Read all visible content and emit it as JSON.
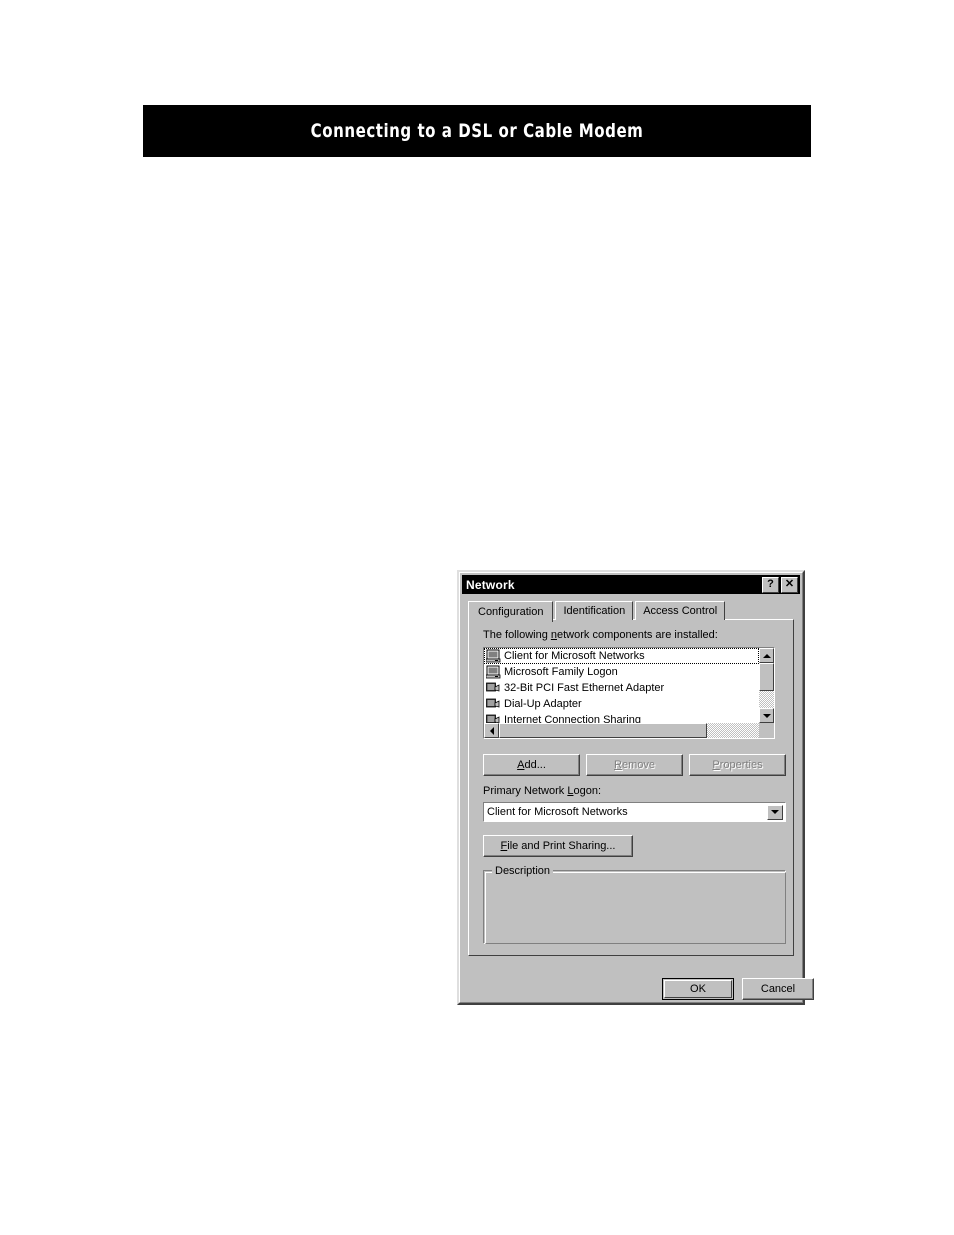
{
  "page": {
    "banner_title": "Connecting to a DSL or Cable Modem"
  },
  "dialog": {
    "title": "Network",
    "titlebar_buttons": [
      {
        "name": "help-button",
        "glyph": "?"
      },
      {
        "name": "close-button",
        "glyph": "✕"
      }
    ],
    "tabs": [
      {
        "label": "Configuration",
        "active": true
      },
      {
        "label": "Identification",
        "active": false
      },
      {
        "label": "Access Control",
        "active": false
      }
    ],
    "components_label_pre": "The following ",
    "components_label_mnemonic": "n",
    "components_label_post": "etwork components are installed:",
    "components": [
      {
        "label": "Client for Microsoft Networks",
        "icon": "client-computer-icon",
        "focused": true
      },
      {
        "label": "Microsoft Family Logon",
        "icon": "client-computer-icon",
        "focused": false
      },
      {
        "label": "32-Bit PCI Fast Ethernet Adapter",
        "icon": "network-adapter-icon",
        "focused": false
      },
      {
        "label": "Dial-Up Adapter",
        "icon": "network-adapter-icon",
        "focused": false
      },
      {
        "label": "Internet Connection Sharing",
        "icon": "network-adapter-icon",
        "focused": false
      }
    ],
    "action_buttons": [
      {
        "label": "Add...",
        "name": "add-button",
        "enabled": true
      },
      {
        "label": "Remove",
        "name": "remove-button",
        "enabled": false
      },
      {
        "label": "Properties",
        "name": "properties-button",
        "enabled": false
      }
    ],
    "primary_logon_label_pre": "Primary Network ",
    "primary_logon_label_mnemonic": "L",
    "primary_logon_label_post": "ogon:",
    "primary_logon_value": "Client for Microsoft Networks",
    "file_print_sharing_label_mnemonic": "F",
    "file_print_sharing_label_post": "ile and Print Sharing...",
    "description_title": "Description",
    "description_text": "",
    "ok_label": "OK",
    "cancel_label": "Cancel"
  },
  "colors": {
    "dialog_face": "#c0c0c0",
    "titlebar": "#000000",
    "banner": "#000000",
    "page_background": "#ffffff",
    "disabled_text": "#808080"
  }
}
